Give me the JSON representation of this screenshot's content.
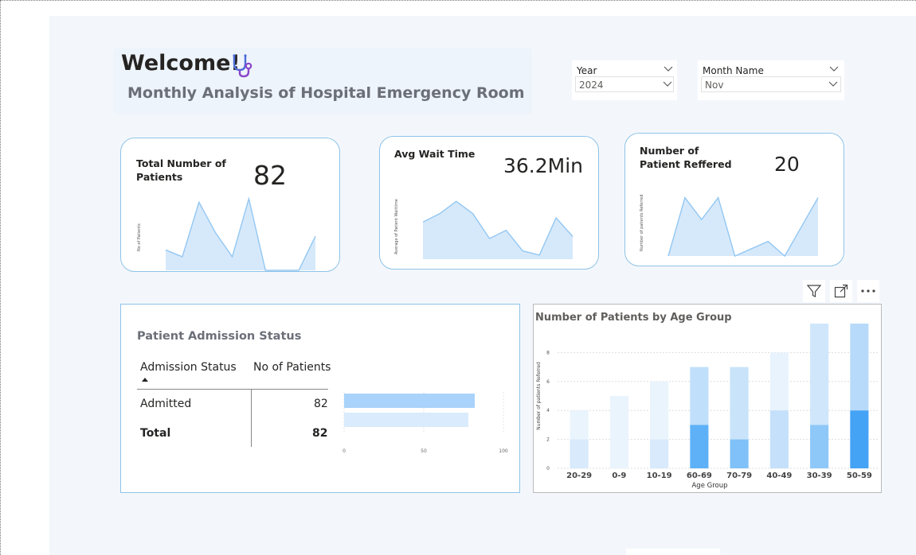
{
  "header": {
    "welcome": "Welcome!",
    "subtitle": "Monthly Analysis of Hospital Emergency Room",
    "icon": "stethoscope-icon"
  },
  "slicers": {
    "year": {
      "label": "Year",
      "value": "2024"
    },
    "month": {
      "label": "Month Name",
      "value": "Nov"
    }
  },
  "kpi": {
    "patients": {
      "label": "Total Number of Patients",
      "value": "82",
      "axis_label": "No of Patients",
      "trend": [
        12,
        8,
        40,
        22,
        8,
        42,
        0,
        0,
        0,
        20
      ]
    },
    "wait": {
      "label": "Avg Wait Time",
      "value": "36.2Min",
      "axis_label": "Average of Patient Waittime",
      "trend": [
        36,
        44,
        56,
        44,
        20,
        28,
        8,
        4,
        40,
        22
      ]
    },
    "referred": {
      "label": "Number of Patient Reffered",
      "value": "20",
      "axis_label": "Number of patients Referred",
      "trend": [
        0,
        8,
        5,
        8,
        0,
        1,
        2,
        0,
        4,
        8
      ]
    }
  },
  "admission": {
    "title": "Patient Admission Status",
    "columns": [
      "Admission Status",
      "No of Patients"
    ],
    "rows": [
      {
        "status": "Admitted",
        "count": "82"
      }
    ],
    "total": {
      "label": "Total",
      "count": "82"
    },
    "bars": [
      82,
      78
    ],
    "axis_ticks": [
      "0",
      "50",
      "100"
    ]
  },
  "chart_data": {
    "type": "bar",
    "title": "Number of Patients by Age Group",
    "xlabel": "Age Group",
    "ylabel": "Number of patients Referred",
    "ylim": [
      0,
      10
    ],
    "yticks": [
      "0",
      "2",
      "4",
      "6",
      "8"
    ],
    "categories": [
      "20-29",
      "0-9",
      "10-19",
      "60-69",
      "70-79",
      "40-49",
      "30-39",
      "50-59"
    ],
    "series": [
      {
        "values": [
          2,
          0,
          2,
          3,
          2,
          4,
          3,
          4
        ]
      },
      {
        "values": [
          2,
          5,
          4,
          4,
          5,
          4,
          7,
          6
        ]
      }
    ],
    "colors": {
      "dark": [
        "#d8eafb",
        "#eaf4fd",
        "#d8eafb",
        "#5eb1f7",
        "#7fc1f8",
        "#c5e0fa",
        "#8ec8f8",
        "#44a3f5"
      ],
      "light": [
        "#eaf4fd",
        "#eaf4fd",
        "#eaf4fd",
        "#c0dffa",
        "#c9e3fa",
        "#e8f3fd",
        "#cfe6fb",
        "#b7dafa"
      ]
    }
  },
  "visual_tools": {
    "filter_icon": "filter-icon",
    "focus_icon": "focus-mode-icon",
    "more_icon": "more-options-icon"
  }
}
